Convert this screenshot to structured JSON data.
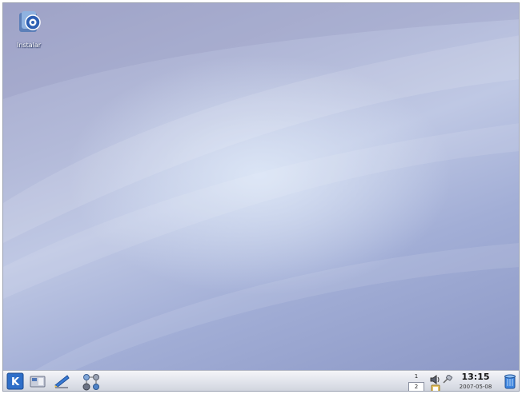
{
  "desktop": {
    "icons": [
      {
        "label": "Instalar",
        "icon": "installer-icon"
      }
    ]
  },
  "taskbar": {
    "kmenu_icon": "k-menu-icon",
    "show_desktop_icon": "show-desktop-icon",
    "quick_launch": [
      {
        "icon": "kate-editor-icon"
      },
      {
        "icon": "users-network-icon"
      }
    ],
    "pager": {
      "desktops": [
        "1",
        "2"
      ],
      "active": "2"
    },
    "tray": [
      {
        "icon": "volume-speaker-icon"
      },
      {
        "icon": "network-plug-icon"
      },
      {
        "icon": "clipboard-icon"
      }
    ],
    "clock": {
      "time": "13:15",
      "date": "2007-05-08"
    },
    "trash_icon": "trash-icon"
  },
  "colors": {
    "wallpaper_light": "#dce6f6",
    "wallpaper_dark": "#8c98c6",
    "taskbar": "#dfe2ea",
    "k_button": "#2f6fc9"
  }
}
